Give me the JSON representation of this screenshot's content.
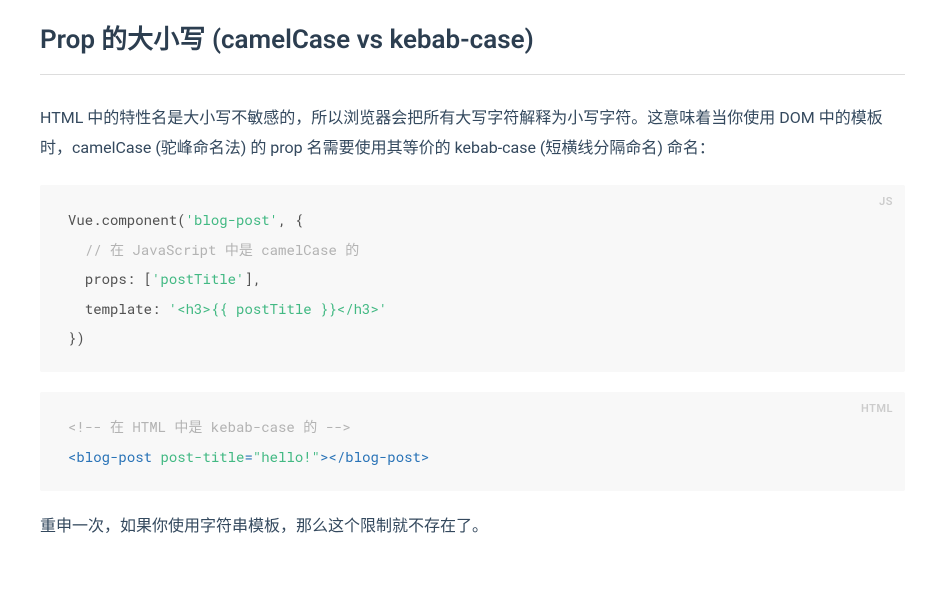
{
  "heading": "Prop 的大小写 (camelCase vs kebab-case)",
  "paragraph1": "HTML 中的特性名是大小写不敏感的，所以浏览器会把所有大写字符解释为小写字符。这意味着当你使用 DOM 中的模板时，camelCase (驼峰命名法) 的 prop 名需要使用其等价的 kebab-case (短横线分隔命名) 命名：",
  "code1": {
    "lang": "JS",
    "p1": "Vue.component(",
    "s1": "'blog-post'",
    "p2": ", {",
    "com": "// 在 JavaScript 中是 camelCase 的",
    "p3": "props: [",
    "s2": "'postTitle'",
    "p4": "],",
    "p5": "template: ",
    "s3": "'<h3>{{ postTitle }}</h3>'",
    "p6": "})"
  },
  "code2": {
    "lang": "HTML",
    "com": "<!-- 在 HTML 中是 kebab-case 的 -->",
    "t1": "<",
    "tag1": "blog-post",
    "sp": " ",
    "attr": "post-title",
    "eq": "=",
    "val": "\"hello!\"",
    "t2": ">",
    "t3": "</",
    "tag2": "blog-post",
    "t4": ">"
  },
  "paragraph2": "重申一次，如果你使用字符串模板，那么这个限制就不存在了。"
}
